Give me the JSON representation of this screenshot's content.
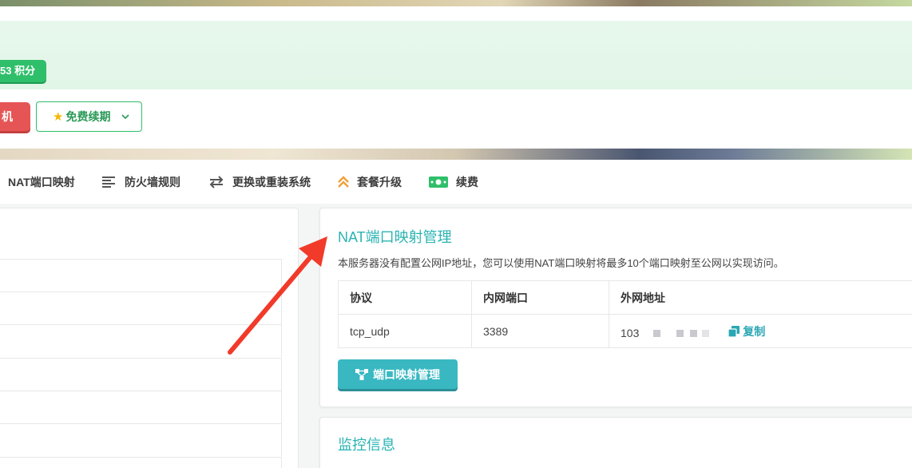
{
  "banner": {
    "points_text": "53 积分",
    "red_button_label": "机",
    "renew_label": "免费续期"
  },
  "nav": {
    "items": [
      {
        "label": "NAT端口映射",
        "icon": "nat-icon"
      },
      {
        "label": "防火墙规则",
        "icon": "align-left-icon"
      },
      {
        "label": "更换或重装系统",
        "icon": "exchange-icon"
      },
      {
        "label": "套餐升级",
        "icon": "double-chevron-up-icon"
      },
      {
        "label": "续费",
        "icon": "money-icon"
      }
    ]
  },
  "nat": {
    "title": "NAT端口映射管理",
    "description": "本服务器没有配置公网IP地址，您可以使用NAT端口映射将最多10个端口映射至公网以实现访问。",
    "headers": [
      "协议",
      "内网端口",
      "外网地址"
    ],
    "rows": [
      {
        "protocol": "tcp_udp",
        "inner_port": "3389",
        "outer_address": "103",
        "copy_label": "复制"
      }
    ],
    "manage_button": "端口映射管理"
  },
  "monitor": {
    "title": "监控信息"
  },
  "colors": {
    "accent_teal": "#2bb3b3",
    "button_teal": "#39b8c2",
    "green": "#2fbf6a",
    "red": "#e65555",
    "arrow_red": "#f23a2a"
  }
}
